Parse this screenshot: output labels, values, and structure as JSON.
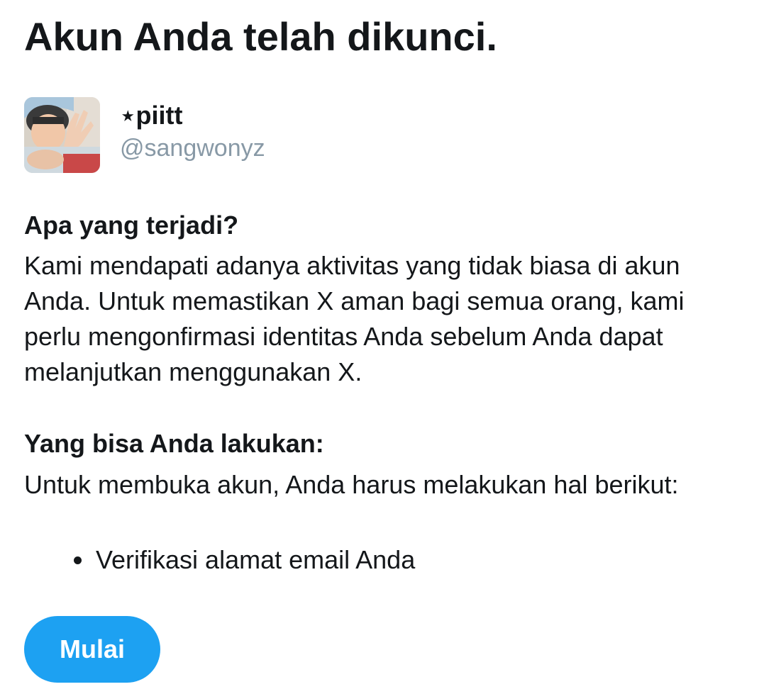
{
  "page": {
    "title": "Akun Anda telah dikunci."
  },
  "profile": {
    "display_name": "⋆piitt",
    "handle": "@sangwonyz"
  },
  "what_happened": {
    "heading": "Apa yang terjadi?",
    "body": "Kami mendapati adanya aktivitas yang tidak biasa di akun Anda. Untuk memastikan X aman bagi semua orang, kami perlu mengonfirmasi identitas Anda sebelum Anda dapat melanjutkan menggunakan X."
  },
  "what_you_can_do": {
    "heading": "Yang bisa Anda lakukan:",
    "body": "Untuk membuka akun, Anda harus melakukan hal berikut:",
    "steps": [
      "Verifikasi alamat email Anda"
    ]
  },
  "actions": {
    "start_label": "Mulai"
  },
  "colors": {
    "accent": "#1da1f2",
    "text": "#14171a",
    "secondary_text": "#8899a6"
  }
}
